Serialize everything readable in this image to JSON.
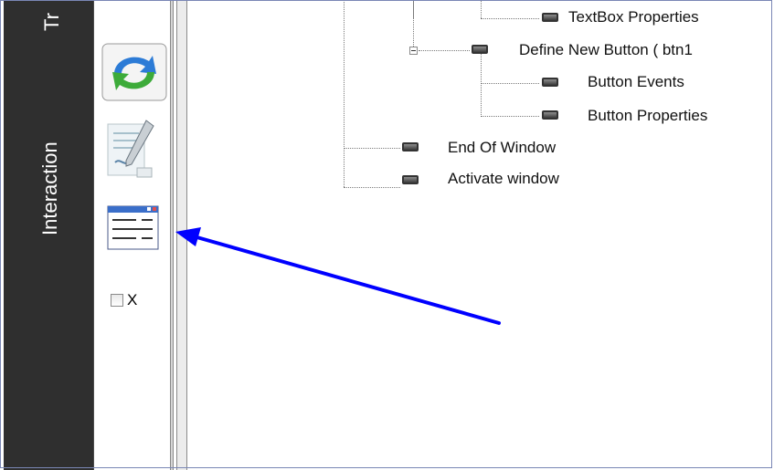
{
  "sidebar": {
    "tab_top": "Tr",
    "tab_interaction": "Interaction"
  },
  "palette": {
    "tools": [
      {
        "icon": "refresh-icon"
      },
      {
        "icon": "edit-document-icon"
      },
      {
        "icon": "window-icon"
      }
    ],
    "checkbox_label": "X",
    "checkbox_checked": false
  },
  "tree": {
    "items": [
      {
        "label": "TextBox Properties"
      },
      {
        "label": "Define New Button ( btn1"
      },
      {
        "label": "Button Events"
      },
      {
        "label": "Button Properties"
      },
      {
        "label": "End Of Window"
      },
      {
        "label": "Activate window"
      }
    ]
  },
  "annotation": {
    "arrow_color": "#0000ff"
  }
}
